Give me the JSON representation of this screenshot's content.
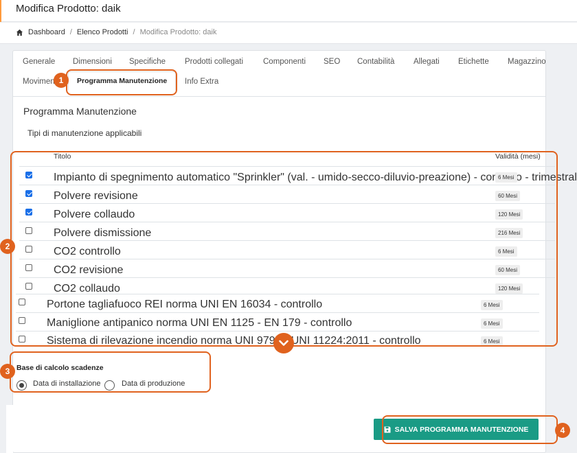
{
  "header": {
    "title": "Modifica Prodotto: daik"
  },
  "breadcrumb": {
    "items": [
      "Dashboard",
      "Elenco Prodotti",
      "Modifica Prodotto: daik"
    ]
  },
  "tabs": [
    "Generale",
    "Dimensioni",
    "Specifiche",
    "Prodotti collegati",
    "Componenti",
    "SEO",
    "Contabilità",
    "Allegati",
    "Etichette",
    "Magazzino",
    "Movimen",
    "Programma Manutenzione",
    "Info Extra"
  ],
  "section": {
    "title": "Programma Manutenzione",
    "subtitle": "Tipi di manutenzione applicabili",
    "col_title": "Titolo",
    "col_validity": "Validità (mesi)"
  },
  "rows": [
    {
      "label": "Impianto di spegnimento automatico \"Sprinkler\" (val. - umido-secco-diluvio-preazione) - controllo - trimestrale",
      "badge": "6 Mesi",
      "checked": true
    },
    {
      "label": "Polvere revisione",
      "badge": "60 Mesi",
      "checked": true
    },
    {
      "label": "Polvere collaudo",
      "badge": "120 Mesi",
      "checked": true
    },
    {
      "label": "Polvere dismissione",
      "badge": "216 Mesi",
      "checked": false
    },
    {
      "label": "CO2 controllo",
      "badge": "6 Mesi",
      "checked": false
    },
    {
      "label": "CO2 revisione",
      "badge": "60 Mesi",
      "checked": false
    },
    {
      "label": "CO2 collaudo",
      "badge": "120 Mesi",
      "checked": false
    },
    {
      "label": "Portone tagliafuoco REI norma UNI EN 16034 - controllo",
      "badge": "6 Mesi",
      "checked": false
    },
    {
      "label": "Maniglione antipanico norma UNI EN 1125 - EN 179 - controllo",
      "badge": "6 Mesi",
      "checked": false
    },
    {
      "label": "Sistema di rilevazione incendio norma UNI 9795 - UNI 11224:2011 - controllo",
      "badge": "6 Mesi",
      "checked": false
    }
  ],
  "base": {
    "title": "Base di calcolo scadenze",
    "options": [
      "Data di installazione",
      "Data di produzione"
    ],
    "selected": "Data di installazione"
  },
  "save_button": {
    "label": "SALVA PROGRAMMA MANUTENZIONE"
  },
  "markers": [
    "1",
    "2",
    "3",
    "4"
  ],
  "colors": {
    "accent": "#e0621e",
    "save": "#1a9b85",
    "checkbox": "#1a6fe8"
  }
}
